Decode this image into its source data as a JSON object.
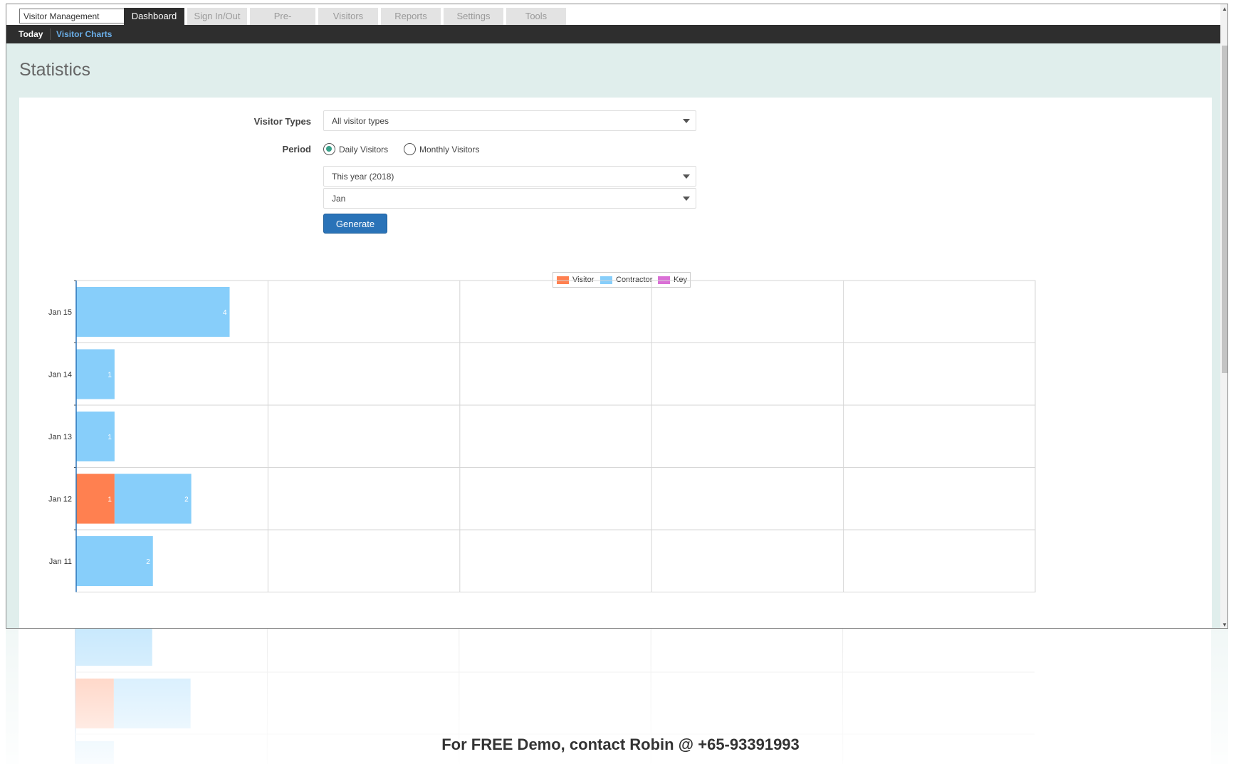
{
  "app_select": {
    "value": "Visitor Management"
  },
  "tabs": [
    {
      "label": "Dashboard",
      "active": true
    },
    {
      "label": "Sign In/Out",
      "active": false
    },
    {
      "label": "Pre-registrations",
      "active": false
    },
    {
      "label": "Visitors",
      "active": false
    },
    {
      "label": "Reports",
      "active": false
    },
    {
      "label": "Settings",
      "active": false
    },
    {
      "label": "Tools",
      "active": false
    }
  ],
  "subtabs": [
    {
      "label": "Today",
      "active": false
    },
    {
      "label": "Visitor Charts",
      "active": true
    }
  ],
  "page_title": "Statistics",
  "form": {
    "visitor_types_label": "Visitor Types",
    "visitor_types_value": "All visitor types",
    "period_label": "Period",
    "radio_daily": "Daily Visitors",
    "radio_monthly": "Monthly Visitors",
    "daily_selected": true,
    "year_value": "This year (2018)",
    "month_value": "Jan",
    "generate_label": "Generate"
  },
  "colors": {
    "visitor": "#ff8050",
    "contractor": "#87cefa",
    "key": "#da70d6",
    "accent": "#2a73b8"
  },
  "chart_data": {
    "type": "bar",
    "orientation": "horizontal",
    "stacked": true,
    "categories": [
      "Jan 15",
      "Jan 14",
      "Jan 13",
      "Jan 12",
      "Jan 11"
    ],
    "series": [
      {
        "name": "Visitor",
        "values": [
          0,
          0,
          0,
          1,
          0
        ]
      },
      {
        "name": "Contractor",
        "values": [
          4,
          1,
          1,
          2,
          2
        ]
      },
      {
        "name": "Key",
        "values": [
          0,
          0,
          0,
          0,
          0
        ]
      }
    ],
    "xlim": [
      0,
      25
    ],
    "grid": true,
    "legend": "top-center"
  },
  "footer": "For FREE Demo, contact Robin @ +65-93391993"
}
